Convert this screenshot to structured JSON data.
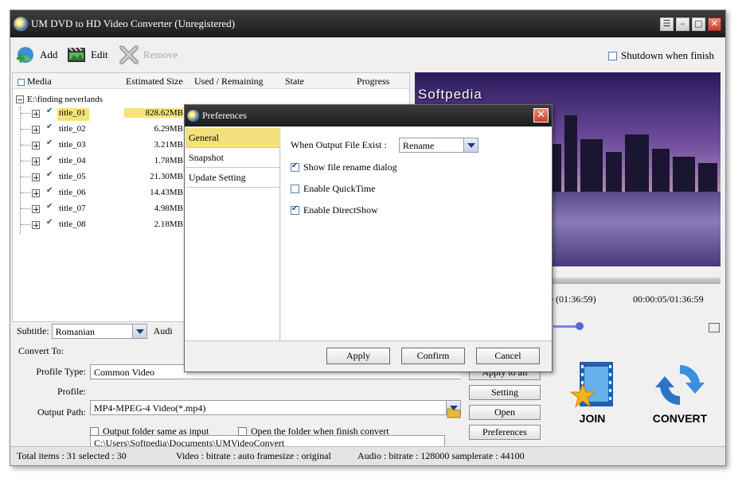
{
  "window": {
    "title": "UM DVD to HD Video Converter  (Unregistered)"
  },
  "toolbar": {
    "add_label": "Add",
    "edit_label": "Edit",
    "remove_label": "Remove",
    "shutdown_label": "Shutdown when finish",
    "shutdown_checked": false
  },
  "list": {
    "headers": {
      "media": "Media",
      "size": "Estimated Size",
      "used": "Used / Remaining",
      "state": "State",
      "progress": "Progress"
    },
    "root": "E:\\finding neverlands",
    "items": [
      {
        "name": "title_01",
        "size": "828.62MB",
        "checked": true,
        "selected": true
      },
      {
        "name": "title_02",
        "size": "6.29MB",
        "checked": true
      },
      {
        "name": "title_03",
        "size": "3.21MB",
        "checked": true
      },
      {
        "name": "title_04",
        "size": "1.78MB",
        "checked": true
      },
      {
        "name": "title_05",
        "size": "21.30MB",
        "checked": true
      },
      {
        "name": "title_06",
        "size": "14.43MB",
        "checked": true
      },
      {
        "name": "title_07",
        "size": "4.98MB",
        "checked": true
      },
      {
        "name": "title_08",
        "size": "2.18MB",
        "checked": true
      }
    ]
  },
  "subtitle": {
    "label": "Subtitle:",
    "value": "Romanian",
    "audio_label": "Audi"
  },
  "preview": {
    "watermark": "Softpedia",
    "time_left": "9 (01:36:59)",
    "time_right": "00:00:05/01:36:59"
  },
  "convert": {
    "heading": "Convert To:",
    "profile_type_label": "Profile Type:",
    "profile_type_value": "Common Video",
    "profile_label": "Profile:",
    "profile_value": "MP4-MPEG-4 Video(*.mp4)",
    "output_path_label": "Output Path:",
    "output_path_value": "C:\\Users\\Softpedia\\Documents\\UMVideoConvert",
    "same_as_input_label": "Output folder same as input",
    "open_when_finish_label": "Open the folder when finish convert",
    "apply_to_all_label": "Apply to all",
    "setting_label": "Setting",
    "open_label": "Open",
    "preferences_label": "Preferences",
    "join_label": "JOIN",
    "convert_label": "CONVERT"
  },
  "status": {
    "items": "Total items : 31  selected : 30",
    "video": "Video : bitrate : auto framesize : original",
    "audio": "Audio : bitrate : 128000 samplerate : 44100"
  },
  "dialog": {
    "title": "Preferences",
    "nav": [
      "General",
      "Snapshot",
      "Update Setting"
    ],
    "active_nav": "General",
    "output_exist_label": "When Output File Exist :",
    "output_exist_value": "Rename",
    "options": [
      {
        "label": "Show file rename dialog",
        "checked": true
      },
      {
        "label": "Enable QuickTime",
        "checked": false
      },
      {
        "label": "Enable DirectShow",
        "checked": true
      }
    ],
    "apply": "Apply",
    "confirm": "Confirm",
    "cancel": "Cancel"
  },
  "colors": {
    "selection": "#f5e27a",
    "titlebar": "#2a2a2a",
    "accent": "#2a6fd8"
  },
  "icons": [
    "add-icon",
    "edit-icon",
    "remove-icon",
    "minimize-icon",
    "maximize-icon",
    "close-icon",
    "folder-icon",
    "join-icon",
    "convert-icon",
    "snapshot-icon"
  ]
}
